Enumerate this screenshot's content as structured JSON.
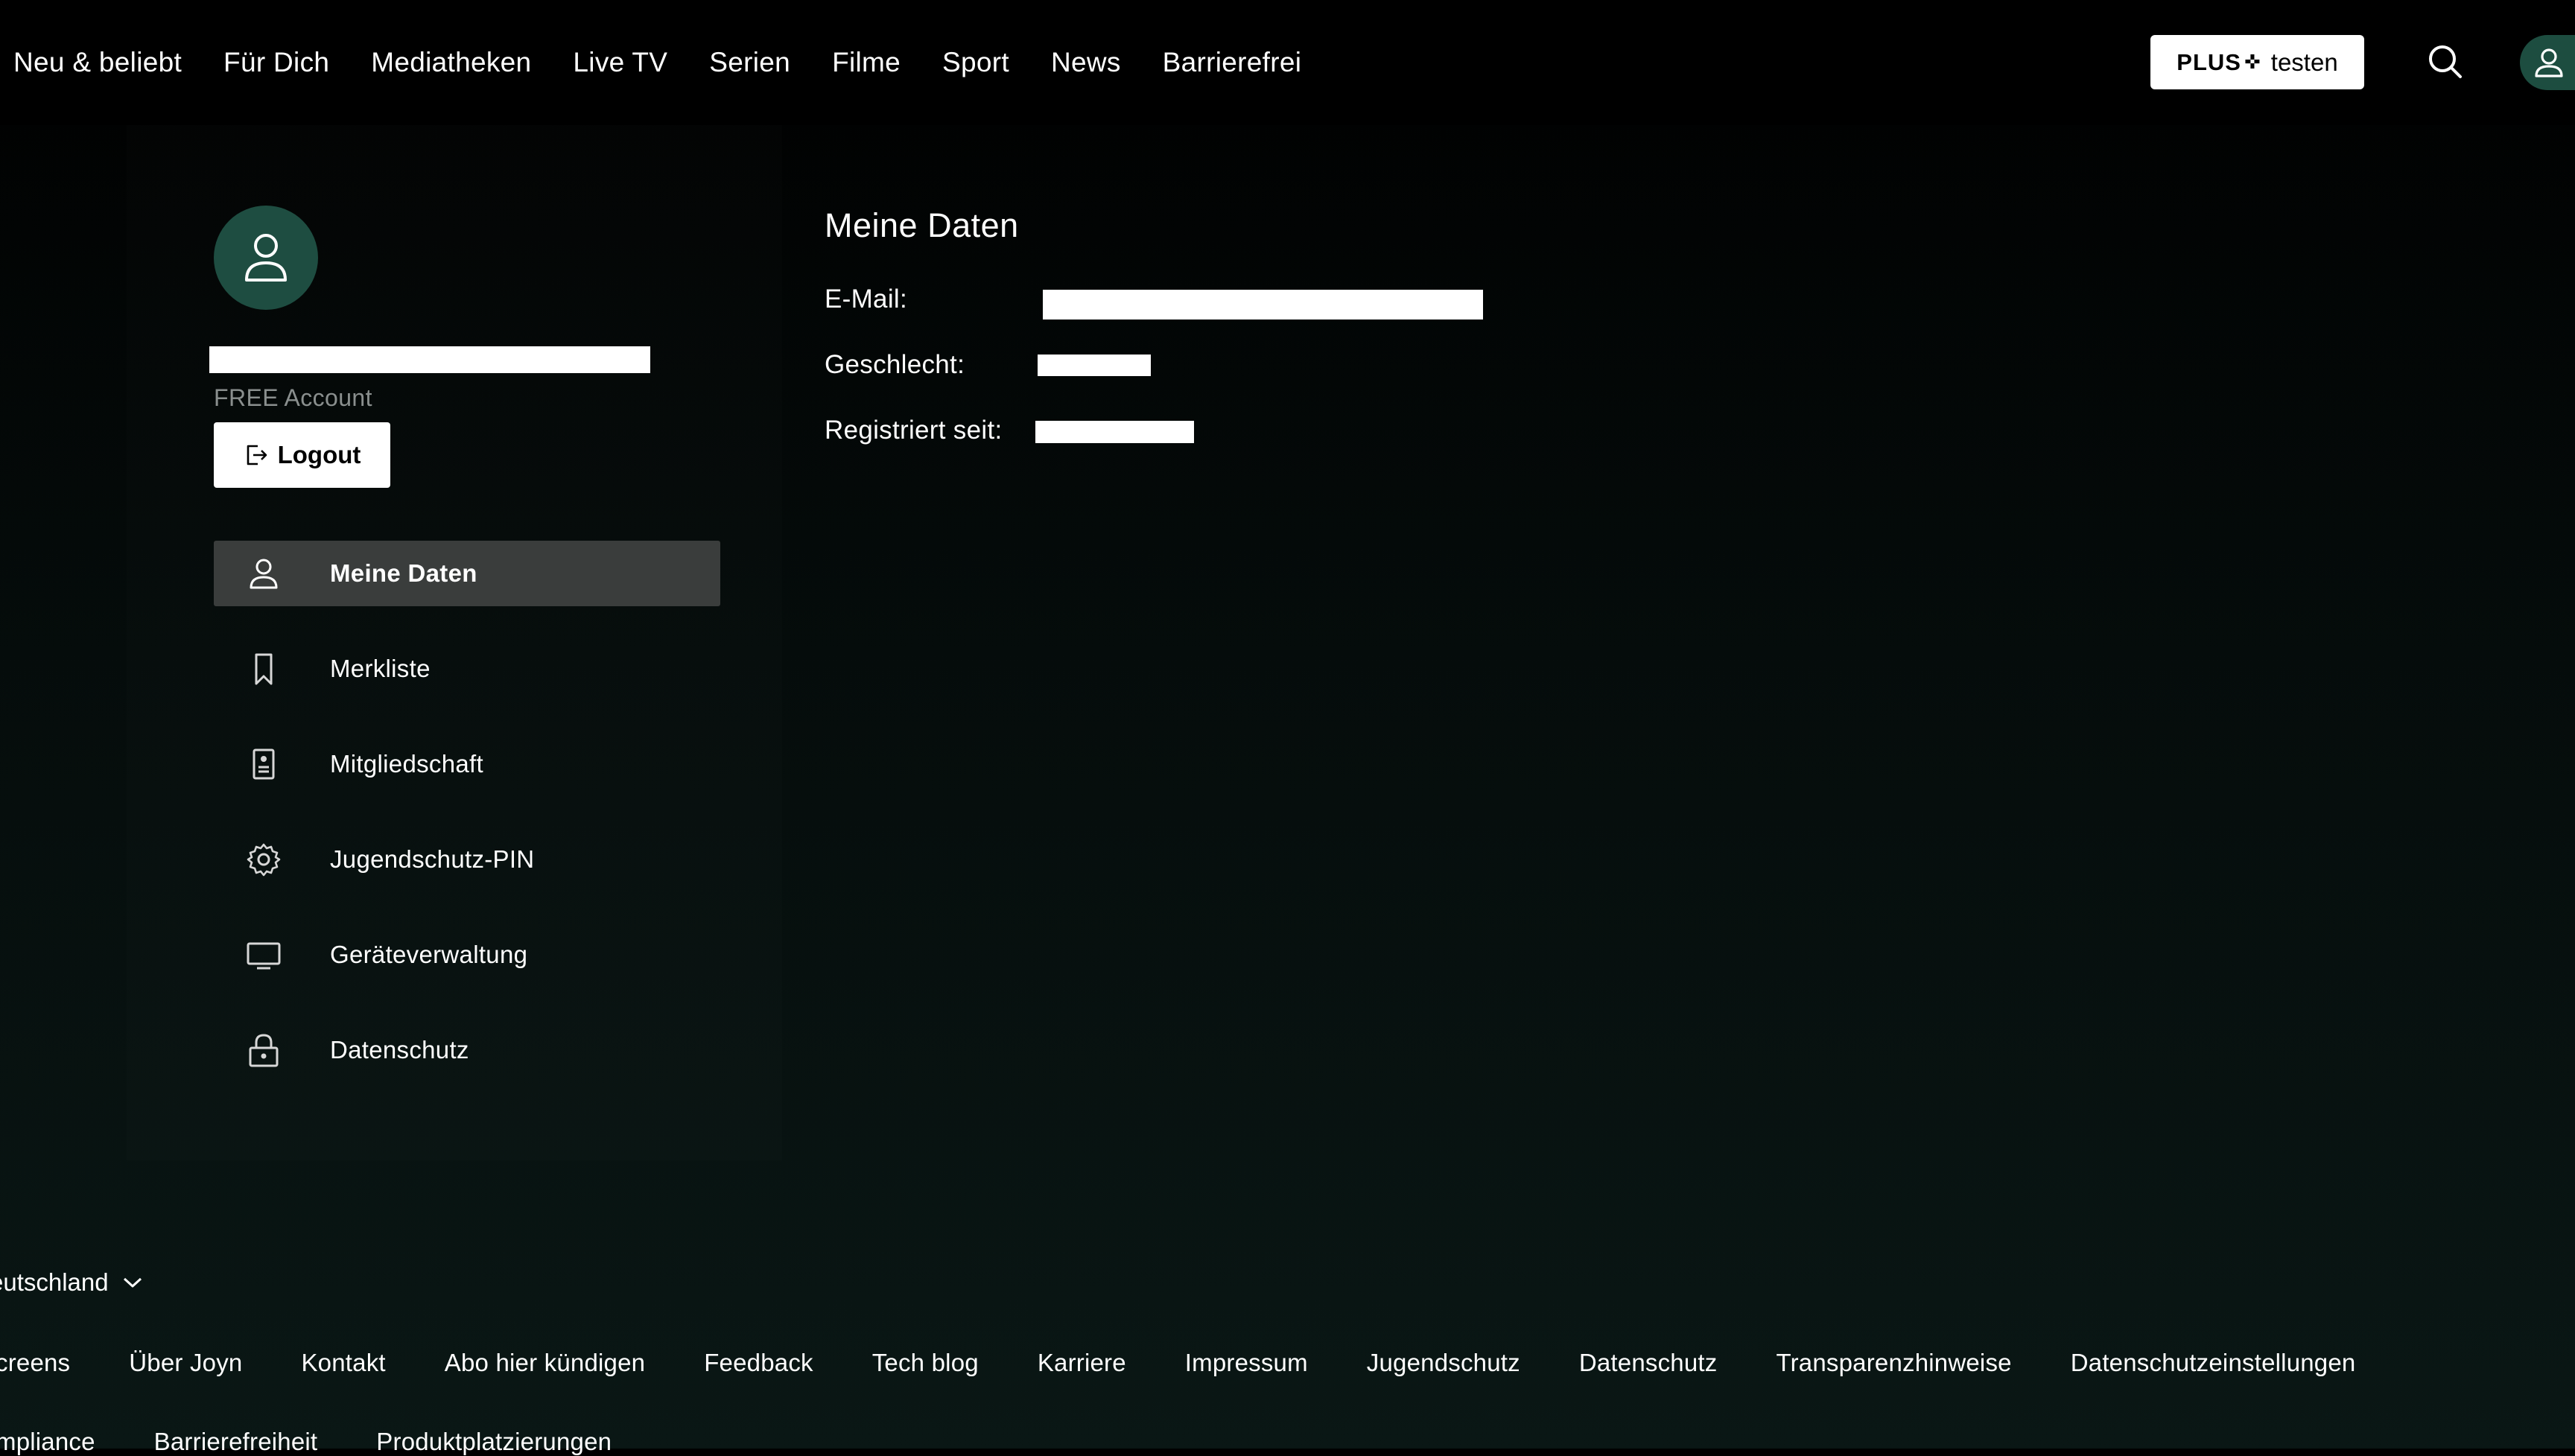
{
  "nav": {
    "links": [
      "Neu & beliebt",
      "Für Dich",
      "Mediatheken",
      "Live TV",
      "Serien",
      "Filme",
      "Sport",
      "News",
      "Barrierefrei"
    ],
    "plus_button": {
      "brand": "PLUS",
      "star": "✜",
      "label": "testen"
    },
    "search_icon": "search-icon",
    "avatar_icon": "user-icon"
  },
  "profile": {
    "account_type": "FREE Account",
    "logout_label": "Logout"
  },
  "sidebar": {
    "items": [
      {
        "label": "Meine Daten",
        "icon": "user-icon",
        "active": true
      },
      {
        "label": "Merkliste",
        "icon": "bookmark-icon",
        "active": false
      },
      {
        "label": "Mitgliedschaft",
        "icon": "membership-card-icon",
        "active": false
      },
      {
        "label": "Jugendschutz-PIN",
        "icon": "gear-icon",
        "active": false
      },
      {
        "label": "Geräteverwaltung",
        "icon": "monitor-icon",
        "active": false
      },
      {
        "label": "Datenschutz",
        "icon": "lock-icon",
        "active": false
      }
    ]
  },
  "main": {
    "title": "Meine Daten",
    "fields": [
      {
        "label": "E-Mail:"
      },
      {
        "label": "Geschlecht:"
      },
      {
        "label": "Registriert seit:"
      }
    ]
  },
  "footer": {
    "language": "eutschland",
    "row1": [
      "creens",
      "Über Joyn",
      "Kontakt",
      "Abo hier kündigen",
      "Feedback",
      "Tech blog",
      "Karriere",
      "Impressum",
      "Jugendschutz",
      "Datenschutz",
      "Transparenzhinweise",
      "Datenschutzeinstellungen"
    ],
    "row2": [
      "mpliance",
      "Barrierefreiheit",
      "Produktplatzierungen"
    ]
  },
  "colors": {
    "background": "#000000",
    "avatar_green": "#1e4d41",
    "active_item": "#3a3d3c",
    "muted_text": "#8a8f8e"
  }
}
